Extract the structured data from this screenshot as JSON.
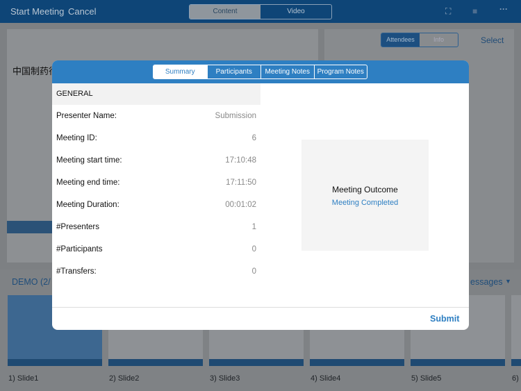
{
  "topbar": {
    "start": "Start Meeting",
    "cancel": "Cancel",
    "segments": [
      "Content",
      "Video"
    ],
    "active": "Content",
    "icons": [
      "fullscreen-icon",
      "video-camera-icon",
      "more-icon"
    ]
  },
  "right_panel": {
    "tabs": [
      "Attendees",
      "Info"
    ],
    "select": "Select"
  },
  "slide_preview": {
    "title": "中国制药行"
  },
  "strip": {
    "demo": "DEMO  (2/",
    "messages": "essages",
    "slides": [
      "1) Slide1",
      "2) Slide2",
      "3) Slide3",
      "4) Slide4",
      "5) Slide5",
      "6)"
    ]
  },
  "modal": {
    "tabs": [
      "Summary",
      "Participants",
      "Meeting Notes",
      "Program Notes"
    ],
    "active_tab": "Summary",
    "section": "GENERAL",
    "rows": [
      {
        "label": "Presenter Name:",
        "value": "Submission"
      },
      {
        "label": "Meeting ID:",
        "value": "6"
      },
      {
        "label": "Meeting start time:",
        "value": "17:10:48"
      },
      {
        "label": "Meeting end time:",
        "value": "17:11:50"
      },
      {
        "label": "Meeting Duration:",
        "value": "00:01:02"
      },
      {
        "label": "#Presenters",
        "value": "1"
      },
      {
        "label": "#Participants",
        "value": "0"
      },
      {
        "label": "#Transfers:",
        "value": "0"
      }
    ],
    "outcome_title": "Meeting Outcome",
    "outcome_value": "Meeting Completed",
    "submit": "Submit"
  },
  "colors": {
    "accent": "#2e7fc2",
    "topbar": "#0e4577"
  }
}
